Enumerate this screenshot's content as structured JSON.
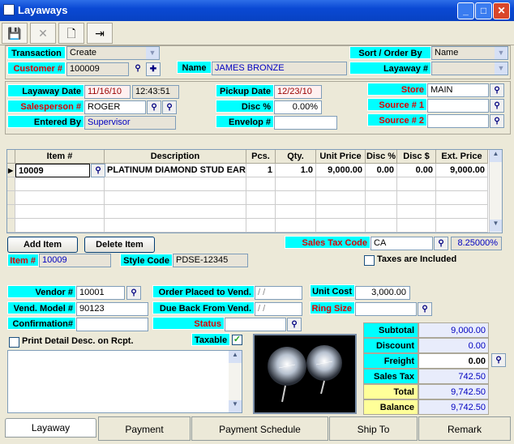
{
  "window": {
    "title": "Layaways",
    "min": "_",
    "max": "□",
    "close": "✕"
  },
  "toolbar": {
    "save": "💾",
    "delete": "✕",
    "new": "🗋",
    "exit": "⇥"
  },
  "header": {
    "transaction_label": "Transaction",
    "transaction_value": "Create",
    "customer_label": "Customer #",
    "customer_value": "100009",
    "name_label": "Name",
    "name_value": "JAMES BRONZE",
    "sort_label": "Sort / Order By",
    "sort_value": "Name",
    "layaway_label": "Layaway #",
    "layaway_value": ""
  },
  "info": {
    "layaway_date_label": "Layaway Date",
    "layaway_date": "11/16/10",
    "layaway_time": "12:43:51",
    "salesperson_label": "Salesperson #",
    "salesperson": "ROGER",
    "entered_by_label": "Entered By",
    "entered_by": "Supervisor",
    "pickup_label": "Pickup Date",
    "pickup_date": "12/23/10",
    "disc_label": "Disc %",
    "disc_value": "0.00%",
    "envelop_label": "Envelop #",
    "envelop_value": "",
    "store_label": "Store",
    "store_value": "MAIN",
    "source1_label": "Source # 1",
    "source1_value": "",
    "source2_label": "Source # 2",
    "source2_value": ""
  },
  "grid": {
    "headers": [
      "Item #",
      "Description",
      "Pcs.",
      "Qty.",
      "Unit Price",
      "Disc %",
      "Disc $",
      "Ext. Price"
    ],
    "rows": [
      {
        "item": "10009",
        "desc": "PLATINUM DIAMOND STUD EARR",
        "pcs": "1",
        "qty": "1.0",
        "unit": "9,000.00",
        "discp": "0.00",
        "discd": "0.00",
        "ext": "9,000.00"
      }
    ]
  },
  "actions": {
    "add_item": "Add Item",
    "delete_item": "Delete Item"
  },
  "tax": {
    "label": "Sales Tax Code",
    "code": "CA",
    "rate": "8.25000%",
    "included_label": "Taxes are Included"
  },
  "item": {
    "item_label": "Item #",
    "item_value": "10009",
    "style_label": "Style Code",
    "style_value": "PDSE-12345"
  },
  "vendor": {
    "vendor_label": "Vendor #",
    "vendor_value": "10001",
    "model_label": "Vend. Model #",
    "model_value": "90123",
    "confirm_label": "Confirmation#",
    "confirm_value": "",
    "order_placed_label": "Order Placed to Vend.",
    "order_placed_value": "/ /",
    "due_back_label": "Due Back From Vend.",
    "due_back_value": "/ /",
    "status_label": "Status",
    "status_value": "",
    "unit_cost_label": "Unit Cost",
    "unit_cost_value": "3,000.00",
    "ring_size_label": "Ring Size",
    "ring_size_value": ""
  },
  "misc": {
    "print_detail_label": "Print Detail Desc. on Rcpt.",
    "taxable_label": "Taxable",
    "taxable_check": "✓"
  },
  "summary": [
    {
      "label": "Subtotal",
      "value": "9,000.00"
    },
    {
      "label": "Discount",
      "value": "0.00"
    },
    {
      "label": "Freight",
      "value": "0.00"
    },
    {
      "label": "Sales Tax",
      "value": "742.50"
    },
    {
      "label": "Total",
      "value": "9,742.50"
    },
    {
      "label": "Balance",
      "value": "9,742.50"
    }
  ],
  "tabs": [
    "Layaway",
    "Payment",
    "Payment Schedule",
    "Ship To",
    "Remark"
  ],
  "colors": {
    "label_bg": "#00ffff",
    "label_red": "#e00000",
    "title_blue": "#0a49d4",
    "value_blue": "#0000c0"
  }
}
